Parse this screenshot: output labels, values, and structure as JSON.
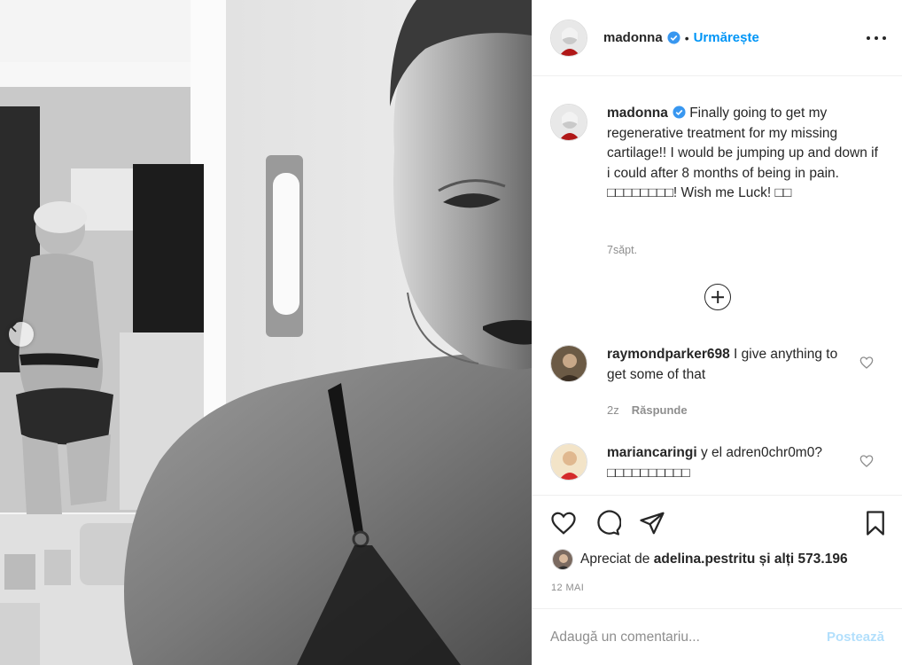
{
  "post": {
    "author": "madonna",
    "follow_label": "Urmărește",
    "dot": "•",
    "caption_text": "Finally going to get my regenerative treatment for my missing cartilage!! I would be jumping up and down if i could after 8 months of being in pain. □□□□□□□□! Wish me Luck! □□",
    "caption_time": "7săpt.",
    "comments": [
      {
        "username": "raymondparker698",
        "text": "I give anything to get some of that",
        "time": "2z",
        "reply_label": "Răspunde"
      },
      {
        "username": "mariancaringi",
        "text": "y el adren0chr0m0? □□□□□□□□□□"
      }
    ],
    "likes": {
      "prefix": "Apreciat de",
      "user": "adelina.pestritu",
      "suffix": "și alți 573.196"
    },
    "date": "12 MAI",
    "add_comment_placeholder": "Adaugă un comentariu...",
    "post_label": "Postează"
  },
  "icons": {
    "verified": "verified-badge-icon",
    "more": "more-options-icon",
    "load_more": "plus-circle-icon",
    "like": "heart-icon",
    "comment": "comment-bubble-icon",
    "share": "paper-plane-icon",
    "save": "bookmark-icon",
    "prev": "chevron-left-icon"
  },
  "colors": {
    "accent": "#0095f6",
    "verified": "#3897f0",
    "muted": "#8e8e8e",
    "post_disabled": "#b2dffc"
  }
}
